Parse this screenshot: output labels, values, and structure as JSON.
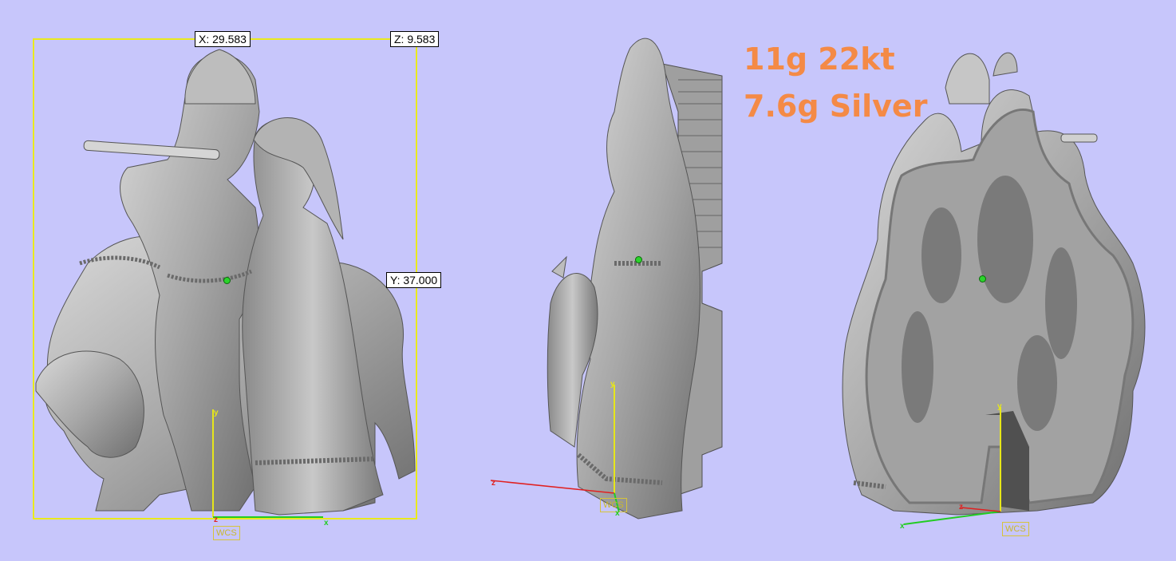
{
  "dimensions": {
    "x_label": "X: 29.583",
    "z_label": "Z: 9.583",
    "y_label": "Y: 37.000"
  },
  "weights": {
    "gold": "11g 22kt",
    "silver": "7.6g Silver"
  },
  "coordinate_system": {
    "label": "WCS",
    "axis_x": "x",
    "axis_y": "y",
    "axis_z": "z"
  },
  "colors": {
    "background": "#c7c6fb",
    "bbox": "#eaea1c",
    "model": "#a9a9a9",
    "weight_text": "#f48a46",
    "axis_x": "#22cc22",
    "axis_y": "#e6e61a",
    "axis_z": "#e02020"
  }
}
